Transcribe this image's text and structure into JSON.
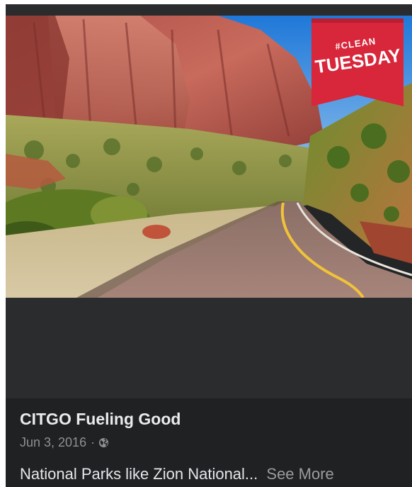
{
  "post": {
    "page_name": "CITGO Fueling Good",
    "date": "Jun 3, 2016",
    "separator": "·",
    "privacy_icon": "globe-icon",
    "caption": "National Parks like Zion National...",
    "see_more_label": "See More"
  },
  "image": {
    "banner_top": "#CLEAN",
    "banner_bottom": "TUESDAY",
    "banner_color": "#d8263a"
  }
}
